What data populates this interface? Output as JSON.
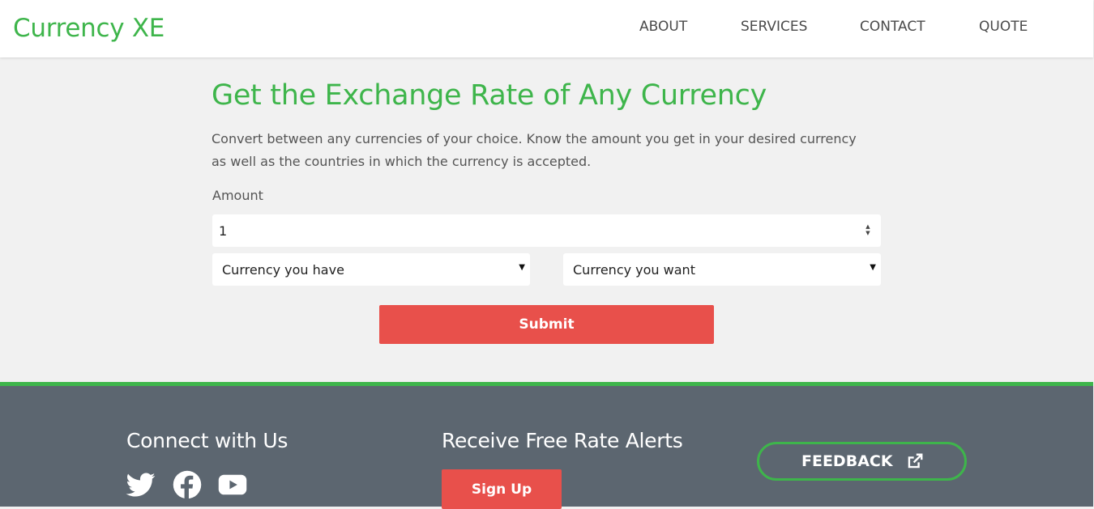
{
  "header": {
    "brand": "Currency XE",
    "nav": [
      "ABOUT",
      "SERVICES",
      "CONTACT",
      "QUOTE"
    ]
  },
  "main": {
    "title": "Get the Exchange Rate of Any Currency",
    "intro": "Convert between any currencies of your choice. Know the amount you get in your desired currency as well as the countries in which the currency is accepted.",
    "amount_label": "Amount",
    "amount_value": "1",
    "select_have": "Currency you have",
    "select_want": "Currency you want",
    "submit_label": "Submit"
  },
  "footer": {
    "connect_heading": "Connect with Us",
    "social_icons": [
      "twitter-icon",
      "facebook-icon",
      "youtube-icon"
    ],
    "alerts_heading": "Receive Free Rate Alerts",
    "signup_label": "Sign Up",
    "feedback_label": "FEEDBACK"
  },
  "colors": {
    "brand_green": "#3eb54b",
    "accent_red": "#e8504b",
    "footer_bg": "#5c6670",
    "page_bg": "#f1f1f1"
  }
}
